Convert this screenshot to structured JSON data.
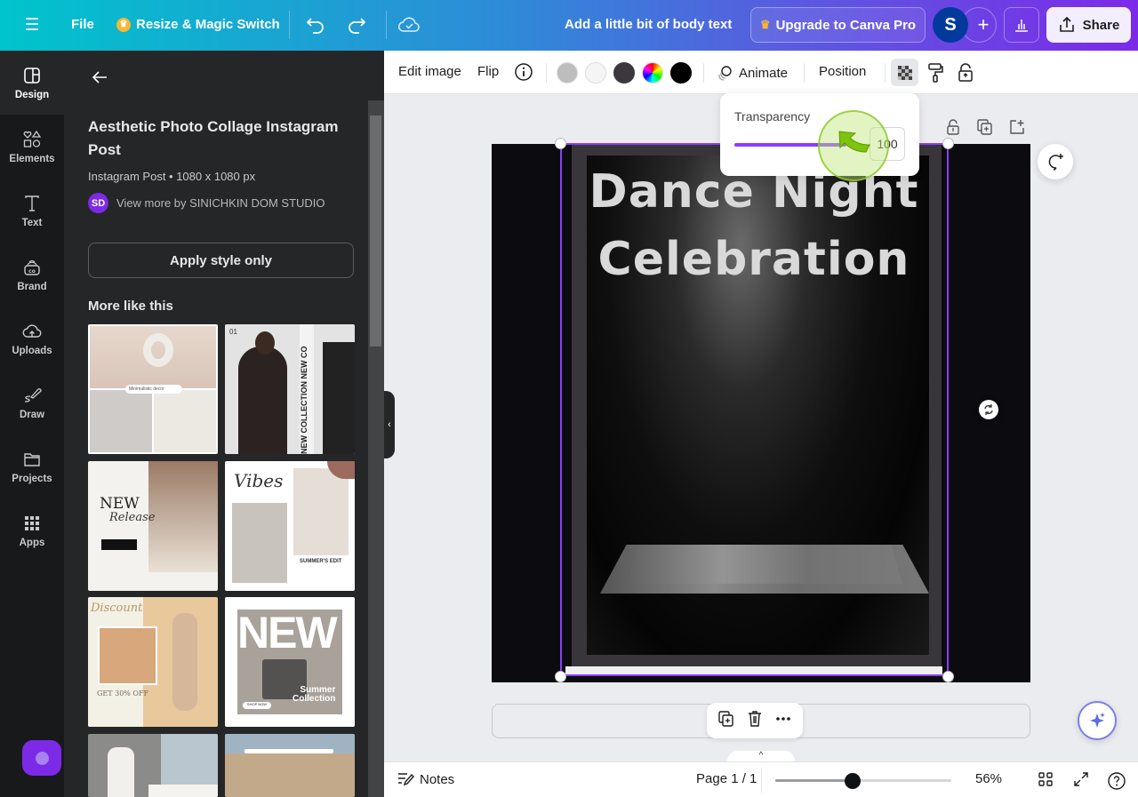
{
  "topbar": {
    "menu_icon": "hamburger-menu-icon",
    "file_label": "File",
    "resize_label": "Resize & Magic Switch",
    "undo_icon": "undo-icon",
    "redo_icon": "redo-icon",
    "cloud_icon": "cloud-saved-icon",
    "doc_title": "Add a little bit of body text",
    "upgrade_label": "Upgrade to Canva Pro",
    "avatar_letter": "S",
    "share_label": "Share",
    "colors": {
      "gradient_start": "#00c4cc",
      "gradient_end": "#7d2ae8",
      "avatar": "#013a9c"
    }
  },
  "rail": {
    "items": [
      {
        "label": "Design",
        "icon": "design-layout-icon",
        "active": true
      },
      {
        "label": "Elements",
        "icon": "elements-shapes-icon"
      },
      {
        "label": "Text",
        "icon": "text-t-icon"
      },
      {
        "label": "Brand",
        "icon": "brand-kit-icon"
      },
      {
        "label": "Uploads",
        "icon": "cloud-upload-icon"
      },
      {
        "label": "Draw",
        "icon": "draw-pen-icon"
      },
      {
        "label": "Projects",
        "icon": "folder-icon"
      },
      {
        "label": "Apps",
        "icon": "apps-grid-icon"
      }
    ]
  },
  "panel": {
    "title": "Aesthetic Photo Collage Instagram Post",
    "subtitle": "Instagram Post • 1080 x 1080 px",
    "author_initials": "SD",
    "author_link": "View more by SINICHKIN DOM STUDIO",
    "apply_label": "Apply style only",
    "more_heading": "More like this",
    "thumbnails": [
      {
        "caption": "Minimalistic decor"
      },
      {
        "caption": "01 NEW COLLECTION NEW CO"
      },
      {
        "caption": "NEW Release"
      },
      {
        "caption": "Vibes SUMMER'S EDIT"
      },
      {
        "caption": "Discount GET 30% OFF"
      },
      {
        "caption": "NEW Summer Collection SHOP NOW"
      },
      {
        "caption": ""
      },
      {
        "caption": ""
      }
    ]
  },
  "context_toolbar": {
    "edit_image": "Edit image",
    "flip": "Flip",
    "info_icon": "info-icon",
    "swatches": [
      "#bdbdbd",
      "#f5f5f5",
      "#3b383d",
      "rainbow",
      "#000000"
    ],
    "animate": "Animate",
    "position": "Position",
    "transparency_icon": "transparency-checker-icon",
    "copy_style_icon": "paint-roller-icon",
    "lock_icon": "lock-icon"
  },
  "transparency": {
    "label": "Transparency",
    "value": "100",
    "percent": 100
  },
  "canvas": {
    "headline_line1": "Dance Night",
    "headline_line2": "Celebration"
  },
  "bottombar": {
    "notes_label": "Notes",
    "page_label": "Page 1 / 1",
    "zoom_label": "56%",
    "zoom_percent": 56
  }
}
